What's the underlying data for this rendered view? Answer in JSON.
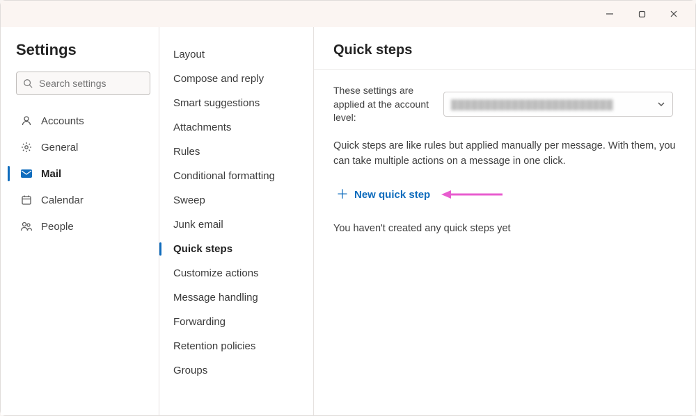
{
  "titlebar": {
    "minimize": "—",
    "maximize": "☐",
    "close": "✕"
  },
  "sidebar": {
    "title": "Settings",
    "search_placeholder": "Search settings",
    "items": [
      {
        "label": "Accounts",
        "icon": "person-icon"
      },
      {
        "label": "General",
        "icon": "gear-icon"
      },
      {
        "label": "Mail",
        "icon": "mail-icon",
        "active": true
      },
      {
        "label": "Calendar",
        "icon": "calendar-icon"
      },
      {
        "label": "People",
        "icon": "people-icon"
      }
    ]
  },
  "submenu": {
    "items": [
      {
        "label": "Layout"
      },
      {
        "label": "Compose and reply"
      },
      {
        "label": "Smart suggestions"
      },
      {
        "label": "Attachments"
      },
      {
        "label": "Rules"
      },
      {
        "label": "Conditional formatting"
      },
      {
        "label": "Sweep"
      },
      {
        "label": "Junk email"
      },
      {
        "label": "Quick steps",
        "active": true
      },
      {
        "label": "Customize actions"
      },
      {
        "label": "Message handling"
      },
      {
        "label": "Forwarding"
      },
      {
        "label": "Retention policies"
      },
      {
        "label": "Groups"
      }
    ]
  },
  "main": {
    "title": "Quick steps",
    "account_label": "These settings are applied at the account level:",
    "account_value": "████████████████████████",
    "description": "Quick steps are like rules but applied manually per message. With them, you can take multiple actions on a message in one click.",
    "new_step_label": "New quick step",
    "empty_message": "You haven't created any quick steps yet"
  },
  "colors": {
    "accent": "#0f6cbd",
    "arrow": "#e85ccf"
  }
}
